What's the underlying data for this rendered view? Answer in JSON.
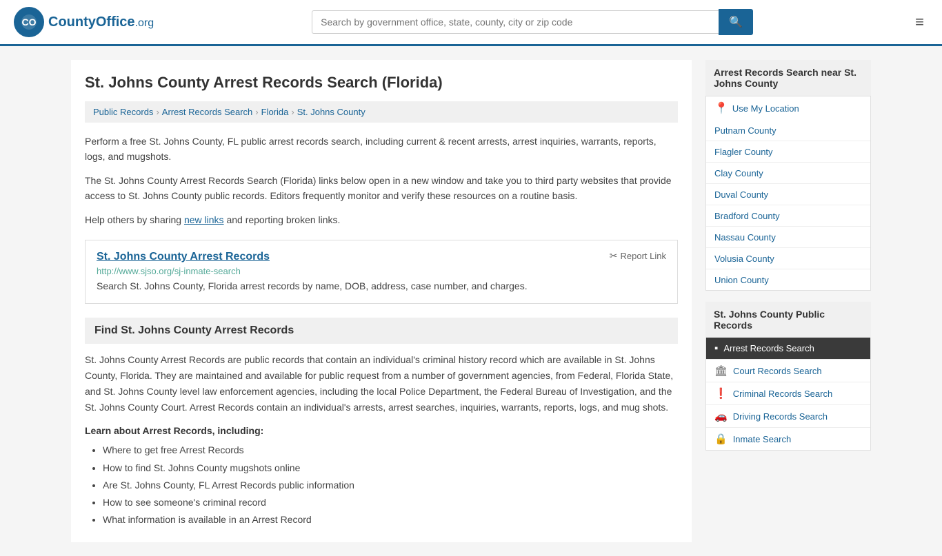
{
  "header": {
    "logo_text": "CountyOffice",
    "logo_domain": ".org",
    "search_placeholder": "Search by government office, state, county, city or zip code"
  },
  "page": {
    "title": "St. Johns County Arrest Records Search (Florida)",
    "description1": "Perform a free St. Johns County, FL public arrest records search, including current & recent arrests, arrest inquiries, warrants, reports, logs, and mugshots.",
    "description2": "The St. Johns County Arrest Records Search (Florida) links below open in a new window and take you to third party websites that provide access to St. Johns County public records. Editors frequently monitor and verify these resources on a routine basis.",
    "description3_prefix": "Help others by sharing ",
    "description3_link": "new links",
    "description3_suffix": " and reporting broken links."
  },
  "breadcrumb": {
    "items": [
      {
        "label": "Public Records",
        "href": "#"
      },
      {
        "label": "Arrest Records Search",
        "href": "#"
      },
      {
        "label": "Florida",
        "href": "#"
      },
      {
        "label": "St. Johns County",
        "href": "#"
      }
    ]
  },
  "record": {
    "title": "St. Johns County Arrest Records",
    "url": "http://www.sjso.org/sj-inmate-search",
    "description": "Search St. Johns County, Florida arrest records by name, DOB, address, case number, and charges.",
    "report_label": "Report Link"
  },
  "section": {
    "find_heading": "Find St. Johns County Arrest Records",
    "find_body": "St. Johns County Arrest Records are public records that contain an individual's criminal history record which are available in St. Johns County, Florida. They are maintained and available for public request from a number of government agencies, from Federal, Florida State, and St. Johns County level law enforcement agencies, including the local Police Department, the Federal Bureau of Investigation, and the St. Johns County Court. Arrest Records contain an individual's arrests, arrest searches, inquiries, warrants, reports, logs, and mug shots.",
    "learn_heading": "Learn about Arrest Records, including:",
    "learn_items": [
      "Where to get free Arrest Records",
      "How to find St. Johns County mugshots online",
      "Are St. Johns County, FL Arrest Records public information",
      "How to see someone's criminal record",
      "What information is available in an Arrest Record"
    ]
  },
  "sidebar": {
    "nearby_title": "Arrest Records Search near St. Johns County",
    "use_my_location": "Use My Location",
    "counties": [
      {
        "label": "Putnam County"
      },
      {
        "label": "Flagler County"
      },
      {
        "label": "Clay County"
      },
      {
        "label": "Duval County"
      },
      {
        "label": "Bradford County"
      },
      {
        "label": "Nassau County"
      },
      {
        "label": "Volusia County"
      },
      {
        "label": "Union County"
      }
    ],
    "public_records_title": "St. Johns County Public Records",
    "public_records": [
      {
        "label": "Arrest Records Search",
        "icon": "▪",
        "active": true
      },
      {
        "label": "Court Records Search",
        "icon": "🏛"
      },
      {
        "label": "Criminal Records Search",
        "icon": "❗"
      },
      {
        "label": "Driving Records Search",
        "icon": "🚗"
      },
      {
        "label": "Inmate Search",
        "icon": "🔒"
      }
    ]
  }
}
